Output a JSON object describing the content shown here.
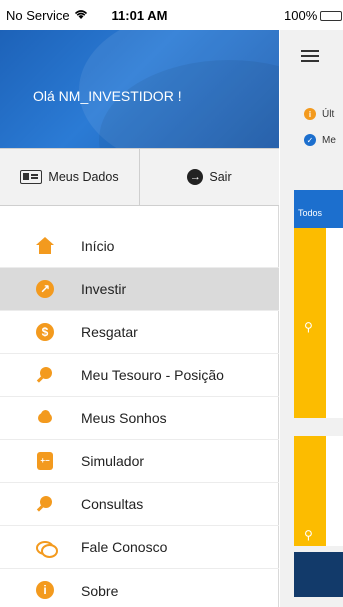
{
  "status_bar": {
    "carrier": "No Service",
    "time": "11:01 AM",
    "battery": "100%",
    "battery_level": 1.0
  },
  "drawer": {
    "greeting": "Olá NM_INVESTIDOR !",
    "actions": [
      {
        "label": "Meus Dados",
        "icon": "id-card-icon"
      },
      {
        "label": "Sair",
        "icon": "exit-icon"
      }
    ],
    "menu": [
      {
        "label": "Início",
        "icon": "home-icon"
      },
      {
        "label": "Investir",
        "icon": "investir-icon",
        "active": true
      },
      {
        "label": "Resgatar",
        "icon": "dollar-icon"
      },
      {
        "label": "Meu Tesouro - Posição",
        "icon": "magnifier-coin-icon"
      },
      {
        "label": "Meus Sonhos",
        "icon": "cloud-icon"
      },
      {
        "label": "Simulador",
        "icon": "calculator-icon"
      },
      {
        "label": "Consultas",
        "icon": "search-icon"
      },
      {
        "label": "Fale Conosco",
        "icon": "chat-icon"
      },
      {
        "label": "Sobre",
        "icon": "info-icon"
      }
    ]
  },
  "content": {
    "notice_1": "Últ",
    "notice_2": "Me",
    "tab_label": "Todos"
  },
  "colors": {
    "accent_orange": "#f39a1e",
    "header_blue": "#1d62b8",
    "tab_blue": "#1c6fce",
    "card_yellow": "#fcbc00",
    "bottom_navy": "#123a6a"
  }
}
